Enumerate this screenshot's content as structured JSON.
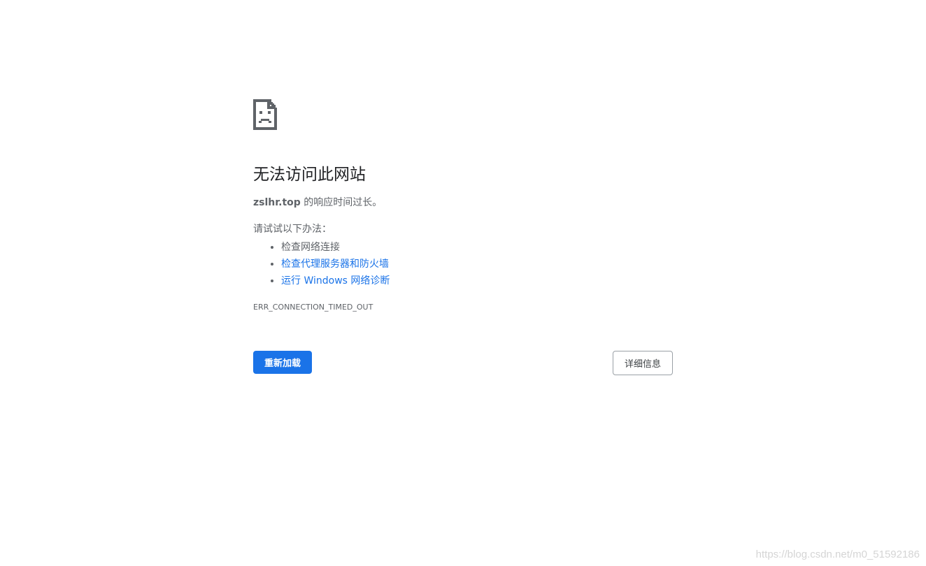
{
  "icon": "sad-page-icon",
  "title": "无法访问此网站",
  "description": {
    "host": "zslhr.top",
    "text": " 的响应时间过长。"
  },
  "suggestions": {
    "heading": "请试试以下办法：",
    "items": [
      {
        "label": "检查网络连接",
        "is_link": false
      },
      {
        "label": "检查代理服务器和防火墙",
        "is_link": true
      },
      {
        "label": "运行 Windows 网络诊断",
        "is_link": true
      }
    ]
  },
  "error_code": "ERR_CONNECTION_TIMED_OUT",
  "buttons": {
    "reload_label": "重新加载",
    "details_label": "详细信息"
  },
  "watermark": "https://blog.csdn.net/m0_51592186",
  "colors": {
    "accent": "#1a73e8",
    "text_primary": "#202124",
    "text_secondary": "#5f6368"
  }
}
